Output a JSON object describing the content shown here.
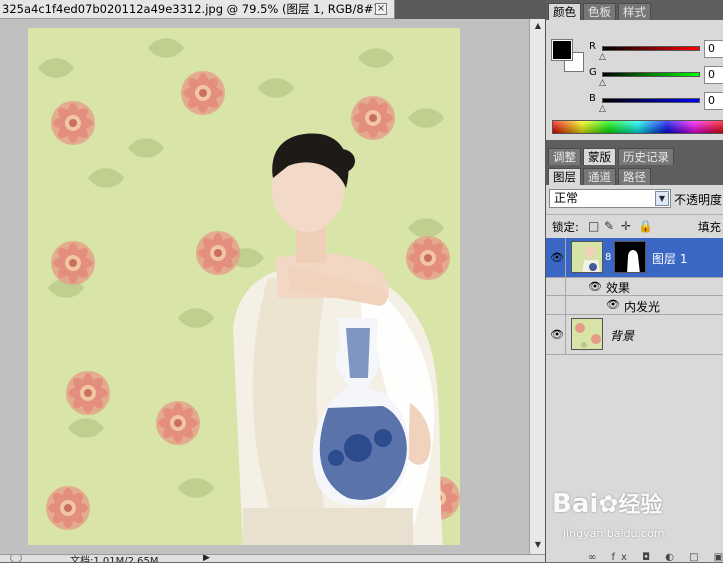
{
  "document": {
    "tab_title": "325a4c1f4ed07b020112a49e3312.jpg @ 79.5% (图层 1, RGB/8#) *",
    "close_symbol": "×",
    "status_text": "文档:1.01M/2.65M",
    "status_nav_symbol": "▶"
  },
  "panels": {
    "color_tabs": [
      "颜色",
      "色板",
      "样式"
    ],
    "color": {
      "sliders": [
        {
          "label": "R",
          "value": "0",
          "gradient": [
            "#000000",
            "#ff0000"
          ]
        },
        {
          "label": "G",
          "value": "0",
          "gradient": [
            "#000000",
            "#00ff00"
          ]
        },
        {
          "label": "B",
          "value": "0",
          "gradient": [
            "#000000",
            "#0000ff"
          ]
        }
      ],
      "foreground": "#000000",
      "background": "#ffffff"
    },
    "adjust_tabs": [
      "调整",
      "蒙版",
      "历史记录"
    ],
    "layer_tabs": [
      "图层",
      "通道",
      "路径"
    ],
    "layers": {
      "blend_mode": "正常",
      "blend_arrow": "▼",
      "opacity_label": "不透明度",
      "lock_label": "锁定:",
      "lock_icons": [
        "□",
        "✎",
        "✛",
        "🔒"
      ],
      "fill_label": "填充",
      "chain_symbol": "8",
      "eye_symbol": "👁",
      "items": [
        {
          "name": "图层 1",
          "selected": true
        },
        {
          "name": "效果"
        },
        {
          "name": "内发光"
        },
        {
          "name": "背景"
        }
      ]
    }
  },
  "watermark": {
    "brand": "Bai",
    "brand2": "经验",
    "url": "jingyan.baidu.com"
  },
  "bottom_icons": "∞ fx ◘ ◐ □ ▣"
}
